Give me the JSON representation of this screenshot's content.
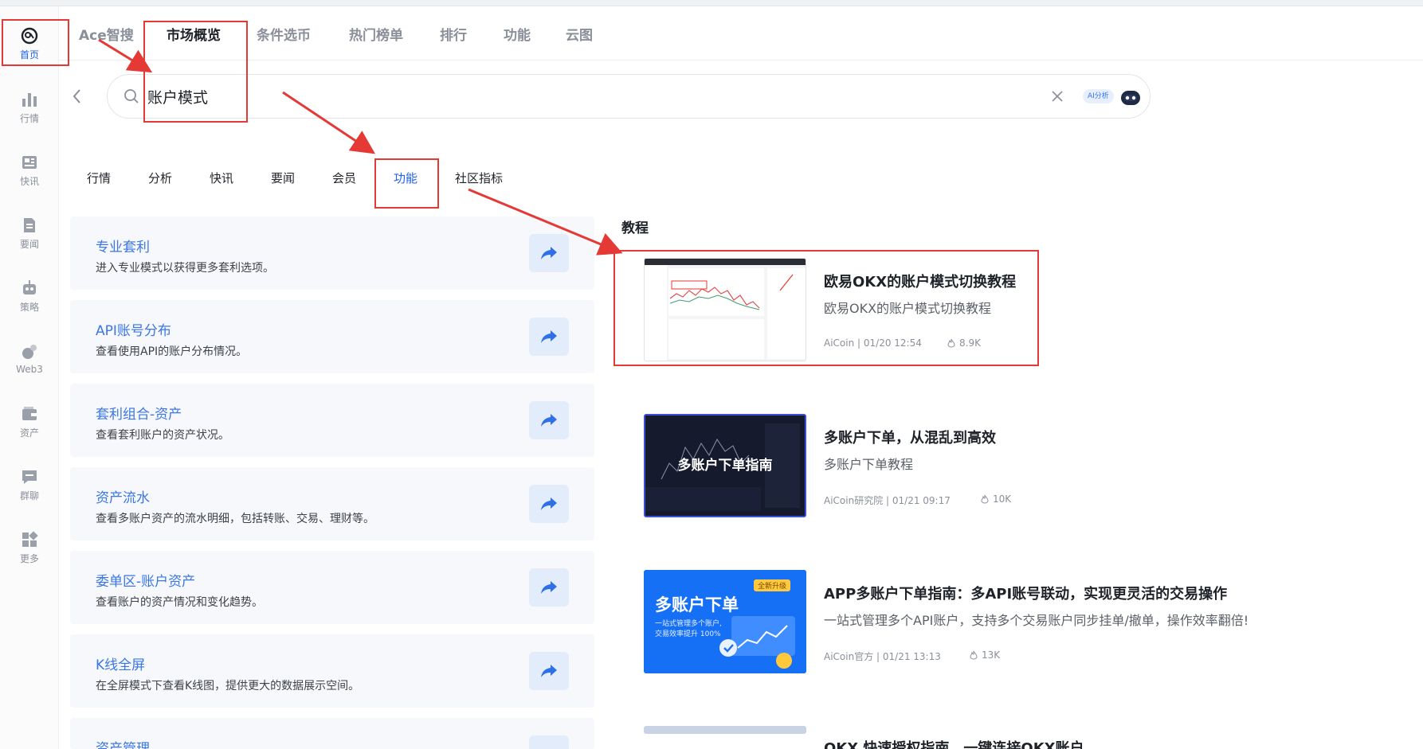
{
  "sidebar": {
    "items": [
      {
        "label": "首页",
        "icon": "aicoin-logo-icon"
      },
      {
        "label": "行情",
        "icon": "bar-chart-icon"
      },
      {
        "label": "快讯",
        "icon": "news-icon"
      },
      {
        "label": "要闻",
        "icon": "document-icon"
      },
      {
        "label": "策略",
        "icon": "robot-icon"
      },
      {
        "label": "Web3",
        "icon": "web3-icon"
      },
      {
        "label": "资产",
        "icon": "wallet-icon"
      },
      {
        "label": "群聊",
        "icon": "chat-icon"
      },
      {
        "label": "更多",
        "icon": "grid-icon"
      }
    ]
  },
  "main_tabs": [
    "Ace智搜",
    "市场概览",
    "条件选币",
    "热门榜单",
    "排行",
    "功能",
    "云图"
  ],
  "search": {
    "value": "账户模式",
    "ai_label": "AI分析"
  },
  "category_tabs": [
    "行情",
    "分析",
    "快讯",
    "要闻",
    "会员",
    "功能",
    "社区指标"
  ],
  "features": [
    {
      "title": "专业套利",
      "desc": "进入专业模式以获得更多套利选项。"
    },
    {
      "title": "API账号分布",
      "desc": "查看使用API的账户分布情况。"
    },
    {
      "title": "套利组合-资产",
      "desc": "查看套利账户的资产状况。"
    },
    {
      "title": "资产流水",
      "desc": "查看多账户资产的流水明细，包括转账、交易、理财等。"
    },
    {
      "title": "委单区-账户资产",
      "desc": "查看账户的资产情况和变化趋势。"
    },
    {
      "title": "K线全屏",
      "desc": "在全屏模式下查看K线图，提供更大的数据展示空间。"
    },
    {
      "title": "资产管理",
      "desc": ""
    }
  ],
  "tutorials": {
    "section_title": "教程",
    "items": [
      {
        "title": "欧易OKX的账户模式切换教程",
        "desc": "欧易OKX的账户模式切换教程",
        "meta": "AiCoin | 01/20 12:54",
        "views": "8.9K",
        "thumb_text": ""
      },
      {
        "title": "多账户下单，从混乱到高效",
        "desc": "多账户下单教程",
        "meta": "AiCoin研究院 | 01/21 09:17",
        "views": "10K",
        "thumb_text": "多账户下单指南"
      },
      {
        "title": "APP多账户下单指南：多API账号联动，实现更灵活的交易操作",
        "desc": "一站式管理多个API账户，支持多个交易账户同步挂单/撤单，操作效率翻倍!",
        "meta": "AiCoin官方 | 01/21 13:13",
        "views": "13K",
        "thumb_text": "多账户下单",
        "thumb_badge": "全新升级",
        "thumb_sub1": "一站式管理多个账户,",
        "thumb_sub2": "交易效率提升 100%"
      },
      {
        "title": "OKX 快速授权指南，一键连接OKX账户",
        "desc": "",
        "meta": "",
        "views": ""
      }
    ]
  },
  "colors": {
    "accent": "#1e62ec",
    "feature_title": "#3a76e6",
    "annotation": "#e53935"
  }
}
